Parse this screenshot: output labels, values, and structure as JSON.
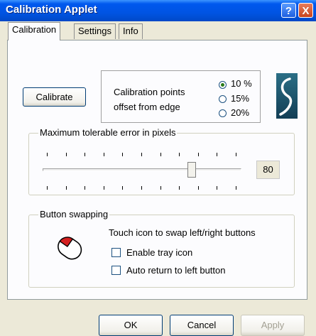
{
  "window": {
    "title": "Calibration Applet",
    "help_glyph": "?",
    "close_glyph": "X"
  },
  "tabs": [
    {
      "label": "Calibration",
      "active": true
    },
    {
      "label": "Settings",
      "active": false
    },
    {
      "label": "Info",
      "active": false
    }
  ],
  "calibration": {
    "calibrate_label": "Calibrate",
    "offset_label_line1": "Calibration points",
    "offset_label_line2": "offset from edge",
    "offset_options": [
      {
        "label": "10 %",
        "selected": true
      },
      {
        "label": "15%",
        "selected": false
      },
      {
        "label": "20%",
        "selected": false
      }
    ]
  },
  "error_slider": {
    "group_label": "Maximum tolerable error in pixels",
    "value": "80",
    "level_fraction": 0.77
  },
  "button_swapping": {
    "group_label": "Button swapping",
    "instruction": "Touch icon to swap left/right buttons",
    "enable_tray_label": "Enable tray icon",
    "enable_tray_checked": false,
    "auto_return_label": "Auto return to left button",
    "auto_return_checked": false
  },
  "footer": {
    "ok_label": "OK",
    "cancel_label": "Cancel",
    "apply_label": "Apply"
  },
  "icons": {
    "logo": "brand-logo-icon",
    "mouse": "mouse-icon"
  },
  "colors": {
    "titlebar": "#0054e3",
    "window_bg": "#ece9d8",
    "panel_bg": "#fcfcfe",
    "radio_dot": "#2a7a1a"
  }
}
